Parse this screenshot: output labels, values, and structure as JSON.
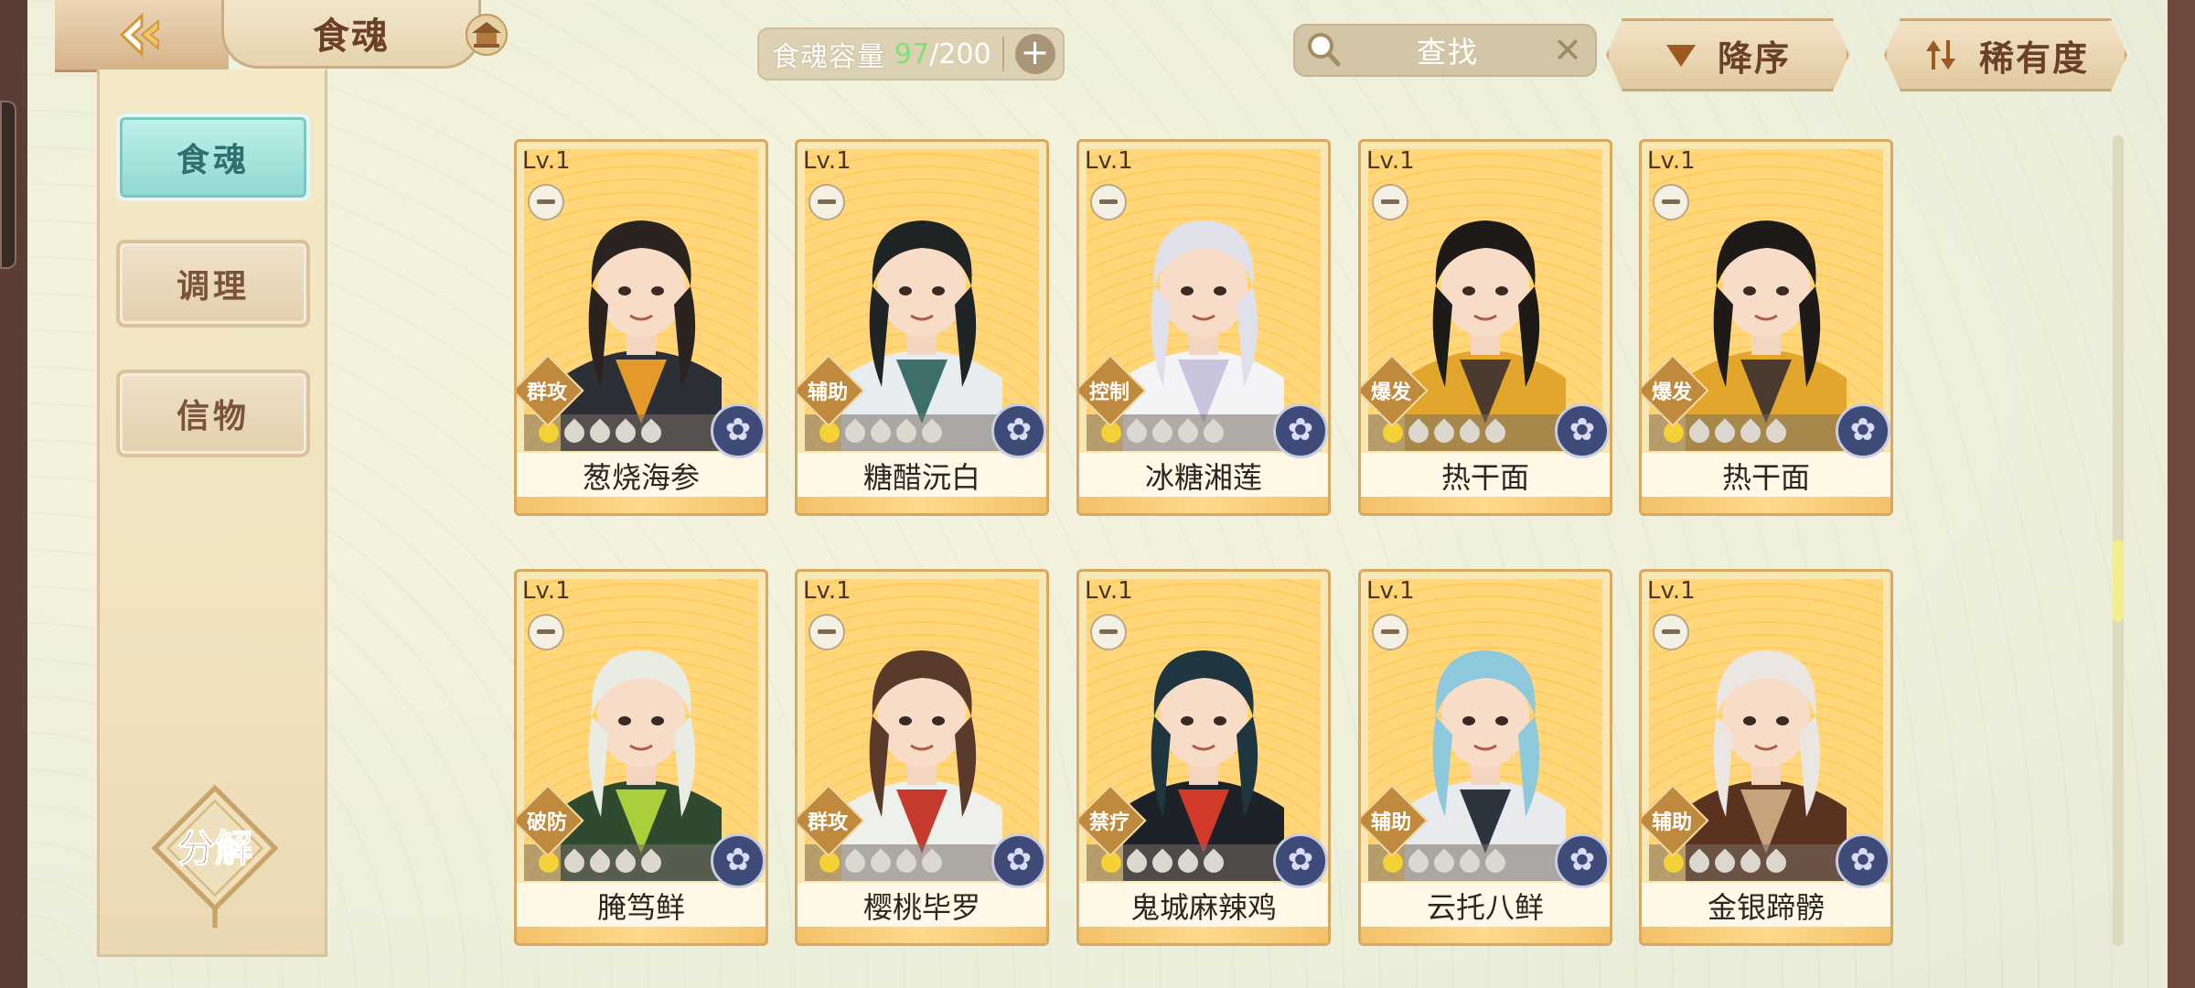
{
  "header": {
    "title": "食魂",
    "capacity_label": "食魂容量",
    "capacity_current": "97",
    "capacity_max": "200",
    "capacity_sep": "/",
    "search_placeholder": "查找",
    "sort_order_label": "降序",
    "sort_field_label": "稀有度"
  },
  "sidebar": {
    "tabs": [
      {
        "label": "食魂",
        "active": true
      },
      {
        "label": "调理",
        "active": false
      },
      {
        "label": "信物",
        "active": false
      }
    ],
    "decompose_label": "分解"
  },
  "cards": [
    {
      "level": "Lv.1",
      "role": "群攻",
      "name": "葱烧海参",
      "stars_lit": 1,
      "stars_total": 5,
      "hair": "#2b2320",
      "outfit": "#2d2f36",
      "accent": "#e39a2a"
    },
    {
      "level": "Lv.1",
      "role": "辅助",
      "name": "糖醋沅白",
      "stars_lit": 1,
      "stars_total": 5,
      "hair": "#1f2424",
      "outfit": "#e7ecef",
      "accent": "#3e6f6a"
    },
    {
      "level": "Lv.1",
      "role": "控制",
      "name": "冰糖湘莲",
      "stars_lit": 1,
      "stars_total": 5,
      "hair": "#dfe0ea",
      "outfit": "#f4f4f7",
      "accent": "#c9c4dc"
    },
    {
      "level": "Lv.1",
      "role": "爆发",
      "name": "热干面",
      "stars_lit": 1,
      "stars_total": 5,
      "hair": "#1d1a18",
      "outfit": "#e2a62c",
      "accent": "#4a3a30"
    },
    {
      "level": "Lv.1",
      "role": "爆发",
      "name": "热干面",
      "stars_lit": 1,
      "stars_total": 5,
      "hair": "#1d1a18",
      "outfit": "#e2a62c",
      "accent": "#4a3a30"
    },
    {
      "level": "Lv.1",
      "role": "破防",
      "name": "腌笃鲜",
      "stars_lit": 1,
      "stars_total": 5,
      "hair": "#e9ece2",
      "outfit": "#2f4a2f",
      "accent": "#a9cf3a"
    },
    {
      "level": "Lv.1",
      "role": "群攻",
      "name": "樱桃毕罗",
      "stars_lit": 1,
      "stars_total": 5,
      "hair": "#5a3a2a",
      "outfit": "#eef0ec",
      "accent": "#c63a2e"
    },
    {
      "level": "Lv.1",
      "role": "禁疗",
      "name": "鬼城麻辣鸡",
      "stars_lit": 1,
      "stars_total": 5,
      "hair": "#1f3540",
      "outfit": "#1c2228",
      "accent": "#d23a2a"
    },
    {
      "level": "Lv.1",
      "role": "辅助",
      "name": "云托八鲜",
      "stars_lit": 1,
      "stars_total": 5,
      "hair": "#8ec8dc",
      "outfit": "#e8eaee",
      "accent": "#2c3440"
    },
    {
      "level": "Lv.1",
      "role": "辅助",
      "name": "金银蹄髈",
      "stars_lit": 1,
      "stars_total": 5,
      "hair": "#ebe6e2",
      "outfit": "#5a3220",
      "accent": "#c7a27a"
    }
  ],
  "colors": {
    "active_tab": "#8fd9d1",
    "card_border": "#d7a860",
    "capacity_current": "#7fe07a"
  }
}
